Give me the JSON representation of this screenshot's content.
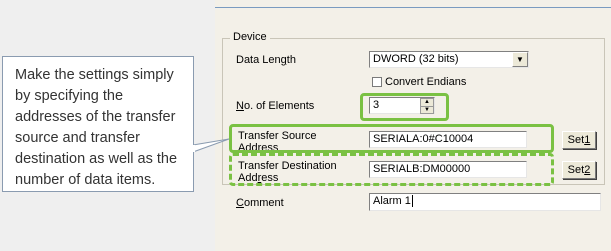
{
  "callout": {
    "text": "Make the settings simply by specifying the addresses of the transfer source and transfer destination as well as the number of data items."
  },
  "device": {
    "group_title": "Device",
    "data_length": {
      "label_pre": "Data Len",
      "label_mnemonic": "g",
      "label_post": "th",
      "value": "DWORD (32 bits)"
    },
    "convert_endians": {
      "label": "Convert Endians",
      "checked": false
    },
    "num_elements": {
      "label_mnemonic": "N",
      "label_post": "o. of Elements",
      "value": "3"
    },
    "transfer_source": {
      "label_line1": "Transfer Source",
      "label_line2": "Address",
      "value": "SERIALA:0#C10004",
      "button_pre": "Set",
      "button_mnemonic": "1"
    },
    "transfer_destination": {
      "label_line1": "Transfer Destination",
      "label_line2_pre": "Add",
      "label_line2_mnemonic": "r",
      "label_line2_post": "ess",
      "value": "SERIALB:DM00000",
      "button_pre": "Set",
      "button_mnemonic": "2"
    },
    "comment": {
      "label_mnemonic": "C",
      "label_post": "omment",
      "value": "Alarm 1"
    }
  },
  "colors": {
    "highlight": "#7ac143",
    "panel_bg": "#f3f0e8",
    "page_bg": "#efefef"
  },
  "icons": {
    "combo_arrow": "chevron-down-icon",
    "spin_up": "spin-up-icon",
    "spin_down": "spin-down-icon"
  }
}
